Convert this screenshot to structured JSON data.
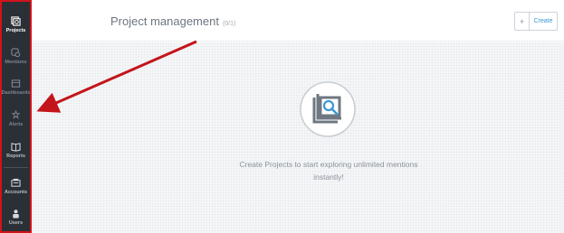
{
  "sidebar": {
    "items": [
      {
        "label": "Projects",
        "icon": "projects-icon"
      },
      {
        "label": "Mentions",
        "icon": "mentions-icon"
      },
      {
        "label": "Dashboards",
        "icon": "dashboards-icon"
      },
      {
        "label": "Alerts",
        "icon": "alerts-icon"
      },
      {
        "label": "Reports",
        "icon": "reports-icon"
      },
      {
        "label": "Accounts",
        "icon": "accounts-icon"
      },
      {
        "label": "Users",
        "icon": "users-icon"
      }
    ]
  },
  "header": {
    "title": "Project management",
    "count": "(0/1)",
    "create_plus": "+",
    "create_label": "Create"
  },
  "empty_state": {
    "message": "Create Projects to start exploring unlimited mentions instantly!"
  },
  "colors": {
    "sidebar_bg": "#2b3036",
    "highlight_red": "#d0141a",
    "accent_blue": "#3b98d4",
    "main_bg": "#f4f5f7"
  }
}
